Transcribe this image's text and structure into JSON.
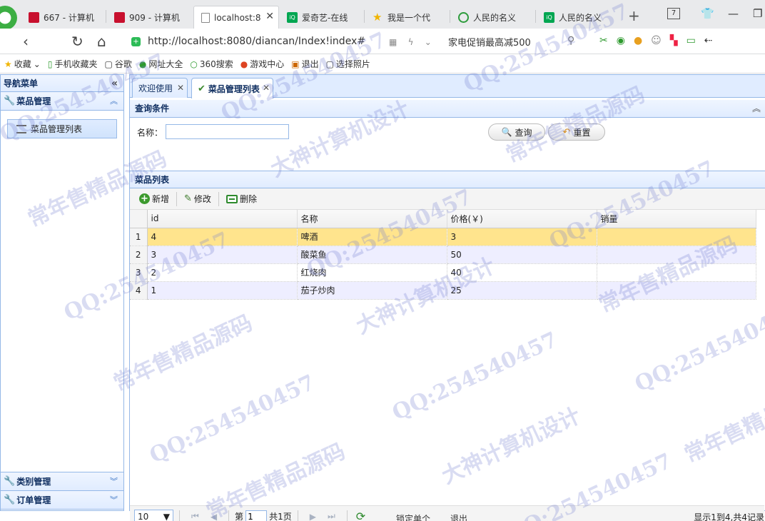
{
  "browser": {
    "tabs": [
      {
        "label": "667 - 计算机",
        "icon": "red-square-icon"
      },
      {
        "label": "909 - 计算机",
        "icon": "red-square-icon"
      },
      {
        "label": "localhost:8",
        "icon": "document-icon",
        "active": true
      },
      {
        "label": "爱奇艺-在线",
        "icon": "iqiyi-icon"
      },
      {
        "label": "我是一个代",
        "icon": "star-icon"
      },
      {
        "label": "人民的名义",
        "icon": "play-circle-icon"
      },
      {
        "label": "人民的名义",
        "icon": "iqiyi-icon"
      }
    ],
    "tab_count": "7",
    "url": "http://localhost:8080/diancan/Index!index#",
    "promo": "家电促销最高减500",
    "bookmarks": [
      "收藏",
      "手机收藏夹",
      "谷歌",
      "网址大全",
      "360搜索",
      "游戏中心",
      "退出",
      "选择照片"
    ]
  },
  "sidebar": {
    "title": "导航菜单",
    "sections": [
      {
        "label": "菜品管理",
        "expanded": true,
        "items": [
          "菜品管理列表"
        ]
      },
      {
        "label": "类别管理",
        "expanded": false
      },
      {
        "label": "订单管理",
        "expanded": false
      }
    ]
  },
  "content_tabs": [
    {
      "label": "欢迎使用"
    },
    {
      "label": "菜品管理列表",
      "selected": true
    }
  ],
  "query": {
    "title": "查询条件",
    "name_label": "名称：",
    "name_value": "",
    "search_label": "查询",
    "reset_label": "重置"
  },
  "dish_list": {
    "title": "菜品列表",
    "toolbar": {
      "add": "新增",
      "edit": "修改",
      "delete": "删除"
    },
    "columns": [
      "id",
      "名称",
      "价格(￥)",
      "销量"
    ],
    "rows": [
      {
        "rn": "1",
        "id": "4",
        "name": "啤酒",
        "price": "3",
        "sales": ""
      },
      {
        "rn": "2",
        "id": "3",
        "name": "酸菜鱼",
        "price": "50",
        "sales": ""
      },
      {
        "rn": "3",
        "id": "2",
        "name": "红烧肉",
        "price": "40",
        "sales": ""
      },
      {
        "rn": "4",
        "id": "1",
        "name": "茄子炒肉",
        "price": "25",
        "sales": ""
      }
    ],
    "selected_row": 0
  },
  "pager": {
    "page_size": "10",
    "page_prefix": "第",
    "page_value": "1",
    "page_total": "共1页",
    "info": "显示1到4,共4记录"
  },
  "footer": {
    "links": [
      "锁定单个",
      "退出"
    ]
  },
  "watermarks": [
    "QQ:254540457",
    "常年售精品源码",
    "大神计算机设计"
  ]
}
